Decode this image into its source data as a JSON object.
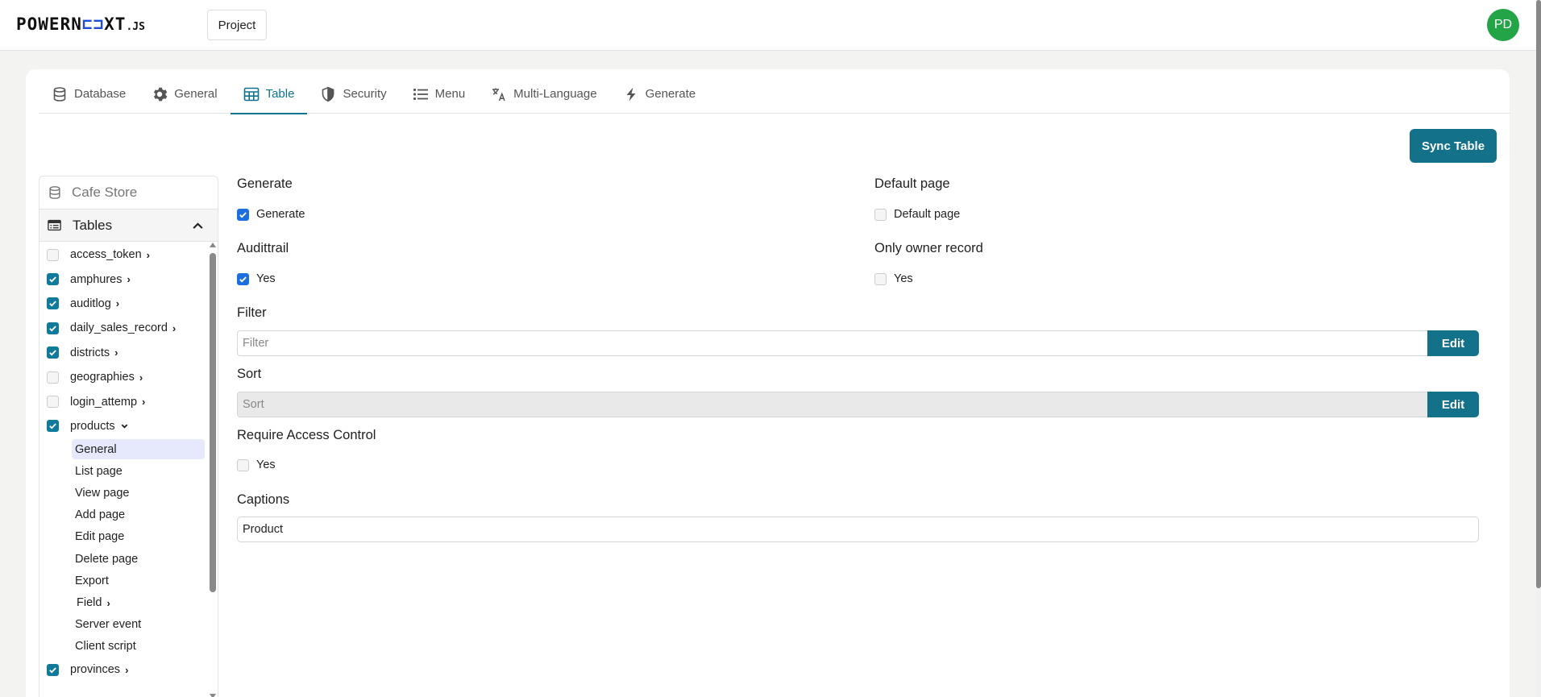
{
  "header": {
    "logo": {
      "part1": "POWERN",
      "part2": "XT",
      "suffix": ".JS",
      "mark_color": "#1d4ed8"
    },
    "project_button": "Project",
    "avatar_initials": "PD",
    "avatar_color": "#22a447"
  },
  "tabs": [
    {
      "label": "Database",
      "icon": "database-icon",
      "active": false
    },
    {
      "label": "General",
      "icon": "gear-icon",
      "active": false
    },
    {
      "label": "Table",
      "icon": "table-icon",
      "active": true
    },
    {
      "label": "Security",
      "icon": "shield-icon",
      "active": false
    },
    {
      "label": "Menu",
      "icon": "list-icon",
      "active": false
    },
    {
      "label": "Multi-Language",
      "icon": "translate-icon",
      "active": false
    },
    {
      "label": "Generate",
      "icon": "bolt-icon",
      "active": false
    }
  ],
  "sync_button": "Sync Table",
  "sidebar": {
    "project_name": "Cafe Store",
    "tables_label": "Tables",
    "tables": [
      {
        "name": "access_token",
        "checked": false,
        "expanded": false
      },
      {
        "name": "amphures",
        "checked": true,
        "expanded": false
      },
      {
        "name": "auditlog",
        "checked": true,
        "expanded": false
      },
      {
        "name": "daily_sales_record",
        "checked": true,
        "expanded": false
      },
      {
        "name": "districts",
        "checked": true,
        "expanded": false
      },
      {
        "name": "geographies",
        "checked": false,
        "expanded": false
      },
      {
        "name": "login_attemp",
        "checked": false,
        "expanded": false
      },
      {
        "name": "products",
        "checked": true,
        "expanded": true,
        "subitems": [
          {
            "label": "General",
            "active": true
          },
          {
            "label": "List page"
          },
          {
            "label": "View page"
          },
          {
            "label": "Add page"
          },
          {
            "label": "Edit page"
          },
          {
            "label": "Delete page"
          },
          {
            "label": "Export"
          },
          {
            "label": "Field",
            "has_children": true
          },
          {
            "label": "Server event"
          },
          {
            "label": "Client script"
          }
        ]
      },
      {
        "name": "provinces",
        "checked": true,
        "expanded": false
      }
    ]
  },
  "form": {
    "generate": {
      "label": "Generate",
      "checkbox_label": "Generate",
      "checked": true
    },
    "default_page": {
      "label": "Default page",
      "checkbox_label": "Default page",
      "checked": false
    },
    "audittrail": {
      "label": "Audittrail",
      "checkbox_label": "Yes",
      "checked": true
    },
    "only_owner_record": {
      "label": "Only owner record",
      "checkbox_label": "Yes",
      "checked": false
    },
    "filter": {
      "label": "Filter",
      "placeholder": "Filter",
      "value": "",
      "edit_label": "Edit"
    },
    "sort": {
      "label": "Sort",
      "placeholder": "Sort",
      "value": "",
      "edit_label": "Edit"
    },
    "require_access_control": {
      "label": "Require Access Control",
      "checkbox_label": "Yes",
      "checked": false
    },
    "captions": {
      "label": "Captions",
      "value": "Product"
    }
  },
  "colors": {
    "accent": "#0e7490",
    "button": "#137189",
    "checkbox_sidebar": "#0f7a9c",
    "checkbox_form": "#1d6fe0"
  }
}
